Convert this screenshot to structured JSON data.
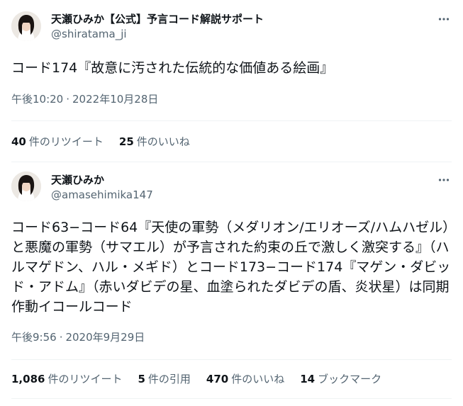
{
  "colors": {
    "text": "#0f1419",
    "secondary": "#536471",
    "divider": "#eff3f4"
  },
  "tweets": [
    {
      "display_name": "天瀬ひみか【公式】予言コード解説サポート",
      "handle": "@shiratama_ji",
      "text": "コード174『故意に汚された伝統的な価値ある絵画』",
      "time": "午後10:20",
      "date": "2022年10月28日",
      "stats": [
        {
          "count": "40",
          "label": "件のリツイート"
        },
        {
          "count": "25",
          "label": "件のいいね"
        }
      ]
    },
    {
      "display_name": "天瀬ひみか",
      "handle": "@amasehimika147",
      "text_lines": [
        "コード63−コード64『天使の軍勢（メダリオン/エリオーズ/ハムハゼル）",
        "と悪魔の軍勢（サマエル）が予言された約束の丘で激しく激突する』（ハ",
        "ルマゲドン、ハル・メギド）とコード173−コード174『マゲン・ダビッ",
        "ド・アドム』（赤いダビデの星、血塗られたダビデの盾、炎状星）は同期",
        "作動イコールコード"
      ],
      "time": "午後9:56",
      "date": "2020年9月29日",
      "stats": [
        {
          "count": "1,086",
          "label": "件のリツイート"
        },
        {
          "count": "5",
          "label": "件の引用"
        },
        {
          "count": "470",
          "label": "件のいいね"
        },
        {
          "count": "14",
          "label": "ブックマーク"
        }
      ]
    }
  ],
  "icons": {
    "more": "more-horizontal-icon",
    "avatar": "avatar-image"
  }
}
